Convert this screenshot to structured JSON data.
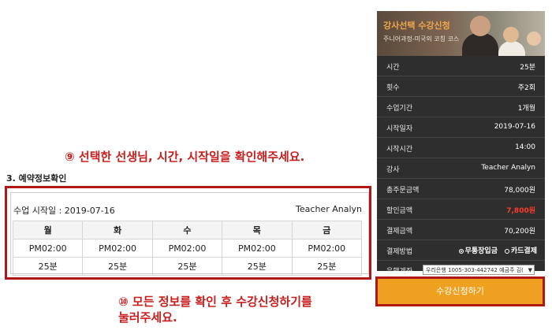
{
  "annotations": {
    "step9": "⑨ 선택한 선생님, 시간, 시작일을 확인해주세요.",
    "step10_line1": "⑩ 모든 정보를 확인 후 수강신청하기를",
    "step10_line2": "눌러주세요."
  },
  "section_title": "3. 예약정보확인",
  "reservation": {
    "start_date_label": "수업 시작일 : 2019-07-16",
    "teacher": "Teacher Analyn",
    "days": [
      "월",
      "화",
      "수",
      "목",
      "금"
    ],
    "times": [
      "PM02:00",
      "PM02:00",
      "PM02:00",
      "PM02:00",
      "PM02:00"
    ],
    "durations": [
      "25분",
      "25분",
      "25분",
      "25분",
      "25분"
    ]
  },
  "panel": {
    "banner_title": "강사선택 수강신청",
    "banner_subtitle": "주니어과정-미국외 코칭 코스",
    "rows": [
      {
        "k": "시간",
        "v": "25분"
      },
      {
        "k": "횟수",
        "v": "주2회"
      },
      {
        "k": "수업기간",
        "v": "1개월"
      },
      {
        "k": "시작일자",
        "v": "2019-07-16"
      },
      {
        "k": "시작시간",
        "v": "14:00"
      },
      {
        "k": "강사",
        "v": "Teacher Analyn"
      },
      {
        "k": "총주문금액",
        "v": "78,000원"
      },
      {
        "k": "할인금액",
        "v": "7,800원"
      },
      {
        "k": "결제금액",
        "v": "70,200원"
      }
    ],
    "payment_label": "결제방법",
    "payment_options": [
      "무통장입금",
      "카드결제"
    ],
    "bank_label": "은행계좌",
    "bank_value": "우리은행 1005-303-442742 예금주 김(",
    "apply_button": "수강신청하기"
  },
  "colors": {
    "annotation_red": "#c81e1e",
    "panel_bg": "#2e2e2e",
    "button_orange": "#f0a020",
    "discount_red": "#ff3a2a"
  }
}
